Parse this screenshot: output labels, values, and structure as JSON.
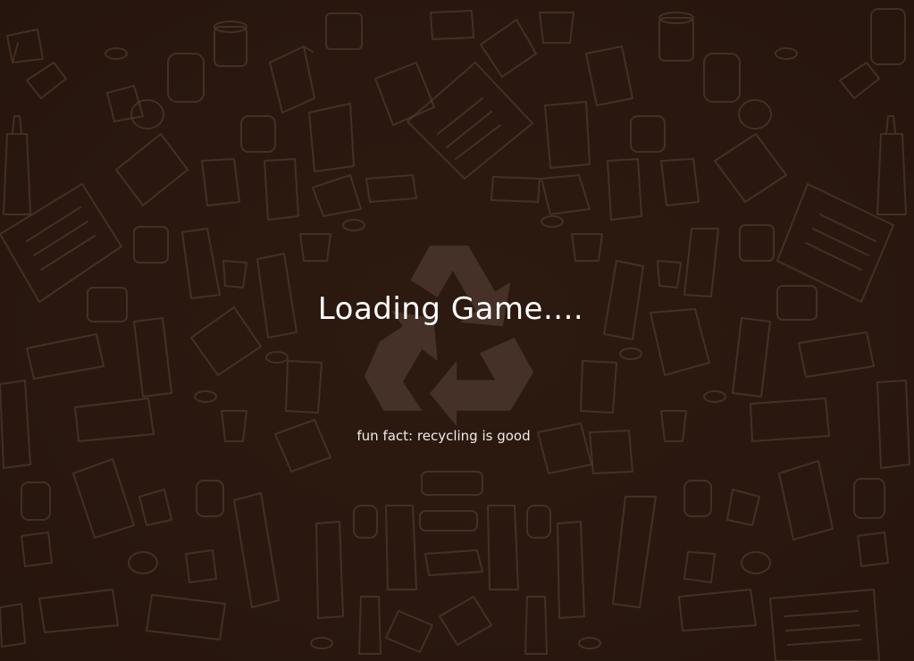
{
  "screen": {
    "loading_title": "Loading Game....",
    "fun_fact": "fun fact: recycling is good"
  },
  "icons": {
    "center": "recycle-icon",
    "background": "doodle-trash-pattern"
  },
  "colors": {
    "background": "#2a180f",
    "doodle_stroke": "#5b4133",
    "recycle_symbol": "#4a362b",
    "title_text": "#ffffff",
    "fact_text": "#f1ebe6"
  }
}
